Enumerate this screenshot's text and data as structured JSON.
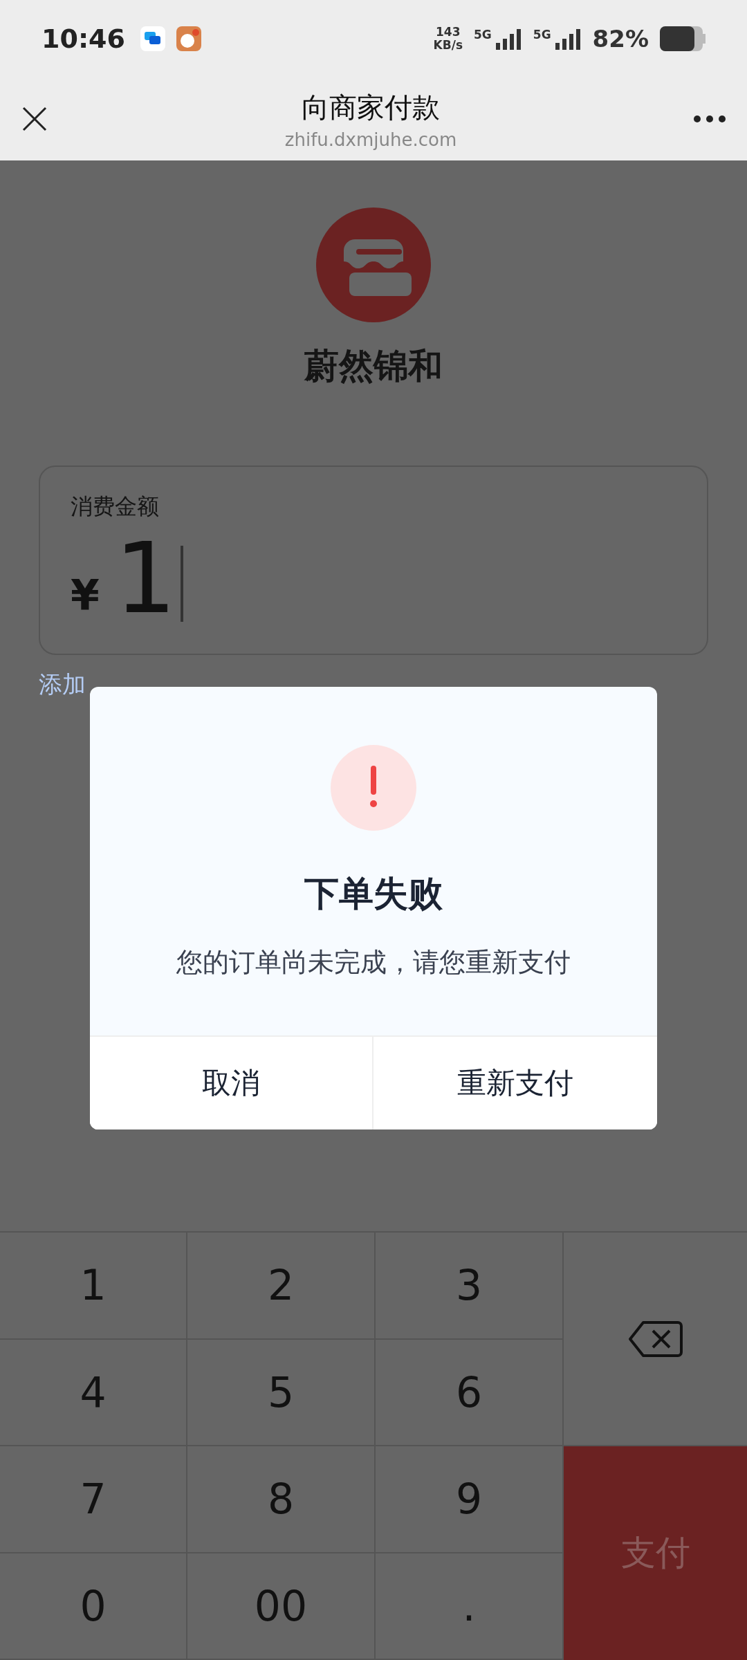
{
  "status_bar": {
    "time": "10:46",
    "speed_value": "143",
    "speed_unit": "KB/s",
    "networks": [
      "5G",
      "5G"
    ],
    "battery": "82%"
  },
  "title_bar": {
    "title": "向商家付款",
    "url": "zhifu.dxmjuhe.com"
  },
  "merchant": {
    "name": "蔚然锦和"
  },
  "amount_card": {
    "label": "消费金额",
    "currency": "¥",
    "value": "1"
  },
  "add_note": "添加",
  "dialog": {
    "title": "下单失败",
    "message": "您的订单尚未完成，请您重新支付",
    "buttons": [
      "取消",
      "重新支付"
    ]
  },
  "keypad": {
    "keys": [
      {
        "kind": "digit",
        "label": "1"
      },
      {
        "kind": "digit",
        "label": "2"
      },
      {
        "kind": "digit",
        "label": "3"
      },
      {
        "kind": "delete"
      },
      {
        "kind": "digit",
        "label": "4"
      },
      {
        "kind": "digit",
        "label": "5"
      },
      {
        "kind": "digit",
        "label": "6"
      },
      {
        "kind": "digit",
        "label": "7"
      },
      {
        "kind": "digit",
        "label": "8"
      },
      {
        "kind": "digit",
        "label": "9"
      },
      {
        "kind": "pay",
        "label": "支付"
      },
      {
        "kind": "digit",
        "label": "0"
      },
      {
        "kind": "digit",
        "label": "00"
      },
      {
        "kind": "digit",
        "label": "."
      }
    ]
  }
}
